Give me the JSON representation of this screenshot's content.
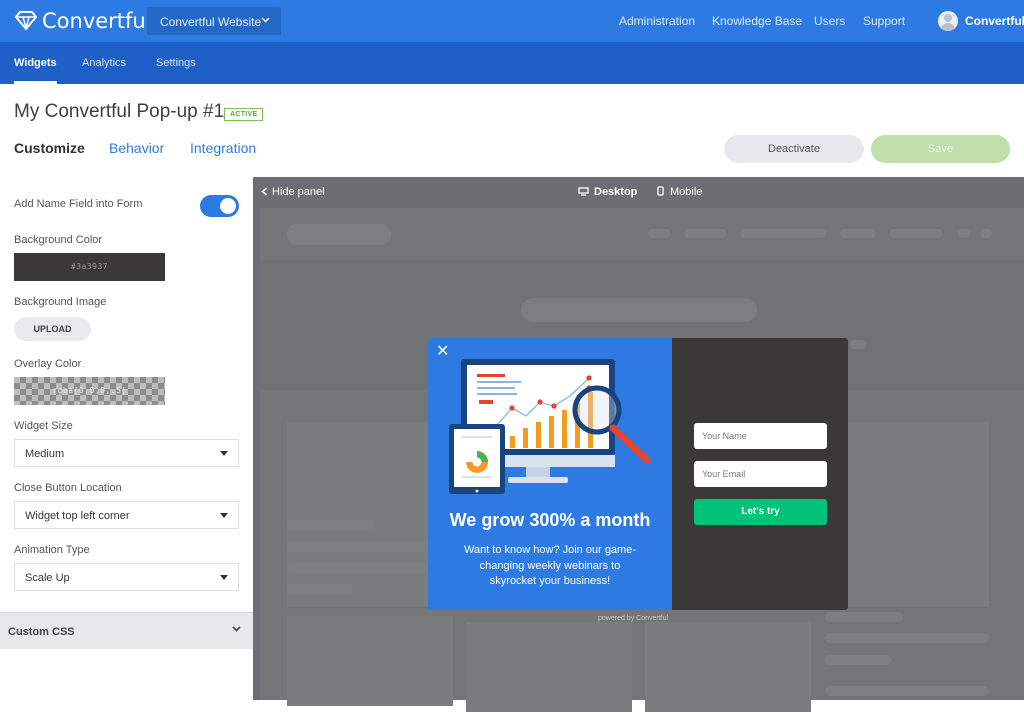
{
  "app": {
    "name": "Convertful",
    "site_selector": "Convertful Website"
  },
  "topnav": {
    "items": [
      "Administration",
      "Knowledge Base",
      "Users",
      "Support"
    ],
    "user": "Convertful"
  },
  "subnav": {
    "items": [
      "Widgets",
      "Analytics",
      "Settings"
    ],
    "active": "Widgets"
  },
  "page": {
    "title": "My Convertful Pop-up #1",
    "status_badge": "ACTIVE",
    "tabs": [
      "Customize",
      "Behavior",
      "Integration"
    ],
    "active_tab": "Customize",
    "deactivate_label": "Deactivate",
    "save_label": "Save"
  },
  "panel": {
    "name_field_label": "Add Name Field into Form",
    "name_field_enabled": true,
    "bg_color_label": "Background Color",
    "bg_color_value": "#3a3937",
    "bg_image_label": "Background Image",
    "upload_label": "UPLOAD",
    "overlay_color_label": "Overlay Color",
    "overlay_color_value": "rgba(0,0,0,.5)",
    "widget_size_label": "Widget Size",
    "widget_size_value": "Medium",
    "close_location_label": "Close Button Location",
    "close_location_value": "Widget top left corner",
    "animation_label": "Animation Type",
    "animation_value": "Scale Up",
    "custom_css_label": "Custom CSS"
  },
  "preview": {
    "hide_panel_label": "Hide panel",
    "desktop_label": "Desktop",
    "mobile_label": "Mobile",
    "powered_by": "powered by Convertful"
  },
  "popup": {
    "title": "We grow 300% a month",
    "text": "Want to know how? Join our game-changing weekly webinars to skyrocket your business!",
    "name_placeholder": "Your Name",
    "email_placeholder": "Your Email",
    "cta_label": "Let's try"
  },
  "colors": {
    "brand": "#2d7be2",
    "subnav": "#1e60c8",
    "cta": "#00c37a",
    "popup_dark": "#3a3937"
  }
}
